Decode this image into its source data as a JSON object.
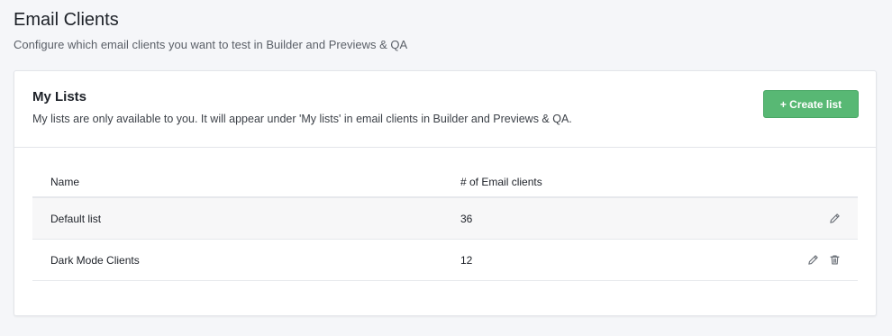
{
  "page": {
    "title": "Email Clients",
    "subtitle": "Configure which email clients you want to test in Builder and Previews & QA"
  },
  "card": {
    "title": "My Lists",
    "description": "My lists are only available to you. It will appear under 'My lists' in email clients in Builder and Previews & QA.",
    "create_button_label": "+ Create list"
  },
  "table": {
    "columns": [
      "Name",
      "# of Email clients"
    ],
    "rows": [
      {
        "name": "Default list",
        "count": "36",
        "actions": [
          "pencil-icon"
        ]
      },
      {
        "name": "Dark Mode Clients",
        "count": "12",
        "actions": [
          "pencil-icon",
          "trash-icon"
        ]
      }
    ]
  },
  "colors": {
    "background": "#f5f6f9",
    "accent_green": "#58b874",
    "icon_gray": "#6b7078"
  }
}
